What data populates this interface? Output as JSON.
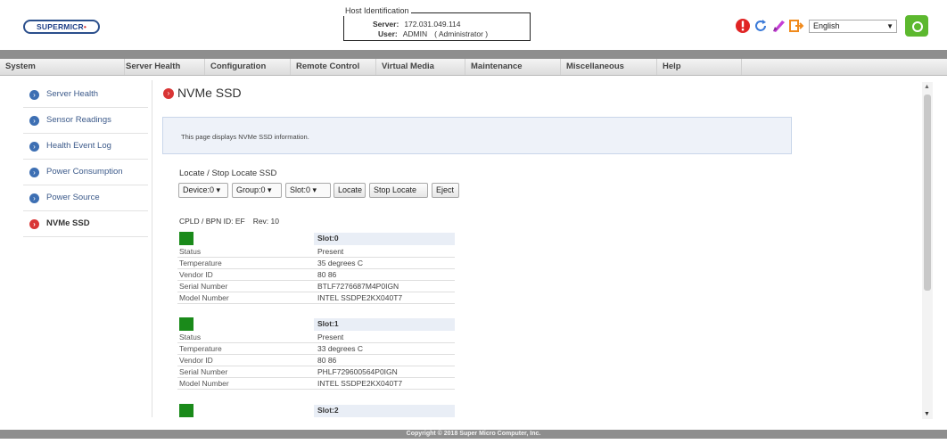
{
  "logo": {
    "text": "SUPERMICR",
    "dot": "•"
  },
  "host": {
    "legend": "Host Identification",
    "server_label": "Server:",
    "server_value": "172.031.049.114",
    "user_label": "User:",
    "user_value": "ADMIN",
    "user_role": "( Administrator )"
  },
  "header_icons": [
    "alert-icon",
    "refresh-icon",
    "pen-icon",
    "logout-icon"
  ],
  "language": {
    "selected": "English"
  },
  "nav": [
    "System",
    "Server Health",
    "Configuration",
    "Remote Control",
    "Virtual Media",
    "Maintenance",
    "Miscellaneous",
    "Help"
  ],
  "sidebar": {
    "items": [
      {
        "label": "Server Health",
        "active": false
      },
      {
        "label": "Sensor Readings",
        "active": false
      },
      {
        "label": "Health Event Log",
        "active": false
      },
      {
        "label": "Power Consumption",
        "active": false
      },
      {
        "label": "Power Source",
        "active": false
      },
      {
        "label": "NVMe SSD",
        "active": true
      }
    ]
  },
  "main": {
    "title": "NVMe SSD",
    "info": "This page displays NVMe SSD information.",
    "locate_title": "Locate / Stop Locate SSD",
    "device_select": "Device:0",
    "group_select": "Group:0",
    "slot_select": "Slot:0",
    "locate_button": "Locate",
    "stop_locate_button": "Stop Locate",
    "eject_button": "Eject",
    "cpld_label": "CPLD / BPN ID: EF",
    "rev_label": "Rev: 10"
  },
  "slot_fields": [
    "Status",
    "Temperature",
    "Vendor ID",
    "Serial Number",
    "Model Number"
  ],
  "slots": [
    {
      "name": "Slot:0",
      "status": "Present",
      "temperature": "35 degrees C",
      "vendor_id": "80 86",
      "serial": "BTLF7276687M4P0IGN",
      "model": "INTEL SSDPE2KX040T7"
    },
    {
      "name": "Slot:1",
      "status": "Present",
      "temperature": "33 degrees C",
      "vendor_id": "80 86",
      "serial": "PHLF729600564P0IGN",
      "model": "INTEL SSDPE2KX040T7"
    },
    {
      "name": "Slot:2"
    }
  ],
  "footer": "Copyright © 2018 Super Micro Computer, Inc.",
  "colors": {
    "slot_present": "#1a8a1a",
    "nav_dark": "#8e8e8e",
    "link": "#3c5a8a",
    "active_icon": "#d93535"
  }
}
